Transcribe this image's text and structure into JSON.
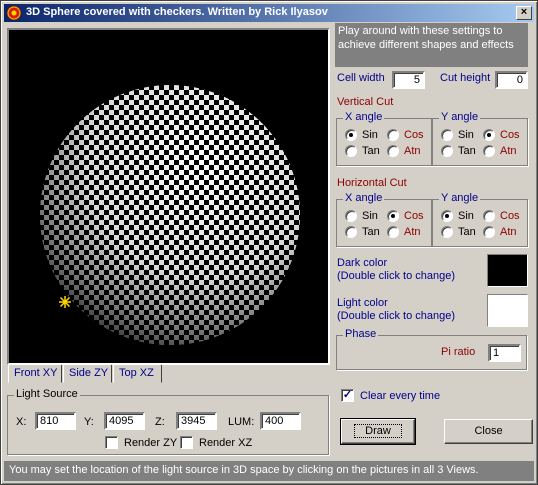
{
  "window": {
    "title": "3D Sphere covered with checkers. Written by Rick Ilyasov",
    "close_glyph": "×"
  },
  "info_text": "Play around with these settings to achieve different shapes and effects",
  "cell_width": {
    "label": "Cell width",
    "value": "5"
  },
  "cut_height": {
    "label": "Cut height",
    "value": "0"
  },
  "vertical_cut": {
    "label": "Vertical Cut",
    "x_angle": {
      "label": "X angle",
      "options": [
        "Sin",
        "Cos",
        "Tan",
        "Atn"
      ],
      "selected": "Sin"
    },
    "y_angle": {
      "label": "Y angle",
      "options": [
        "Sin",
        "Cos",
        "Tan",
        "Atn"
      ],
      "selected": "Cos"
    }
  },
  "horizontal_cut": {
    "label": "Horizontal Cut",
    "x_angle": {
      "label": "X angle",
      "options": [
        "Sin",
        "Cos",
        "Tan",
        "Atn"
      ],
      "selected": "Cos"
    },
    "y_angle": {
      "label": "Y angle",
      "options": [
        "Sin",
        "Cos",
        "Tan",
        "Atn"
      ],
      "selected": "Sin"
    }
  },
  "dark_color": {
    "label1": "Dark color",
    "label2": "(Double click to change)",
    "color": "#000000"
  },
  "light_color": {
    "label1": "Light color",
    "label2": "(Double click to change)",
    "color": "#ffffff"
  },
  "phase": {
    "label": "Phase",
    "pi_ratio_label": "Pi ratio",
    "pi_ratio_value": "1"
  },
  "tabs": [
    "Front XY",
    "Side ZY",
    "Top XZ"
  ],
  "active_tab": "Front XY",
  "light_source": {
    "label": "Light Source",
    "x_label": "X:",
    "x": "810",
    "y_label": "Y:",
    "y": "4095",
    "z_label": "Z:",
    "z": "3945",
    "lum_label": "LUM:",
    "lum": "400",
    "render_zy": "Render ZY",
    "render_xz": "Render XZ"
  },
  "clear_every_time": {
    "label": "Clear every time",
    "checked": true
  },
  "buttons": {
    "draw": "Draw",
    "close": "Close"
  },
  "status_text": "You may set the location of the light source in 3D space by clicking on the pictures in all 3 Views.",
  "icons": {
    "light": "light-sun-icon",
    "app": "app-icon"
  }
}
